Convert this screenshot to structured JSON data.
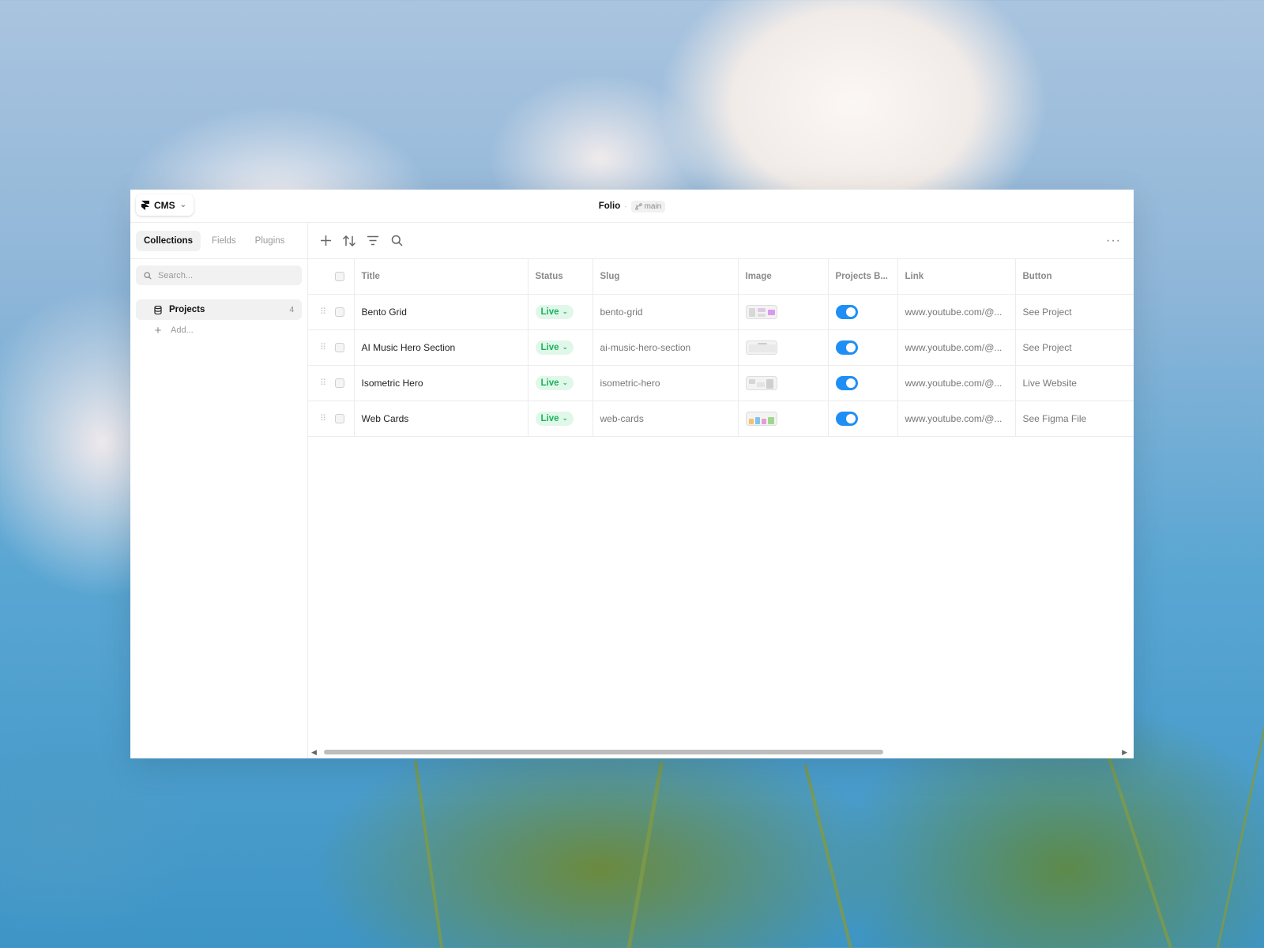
{
  "window": {
    "app_button_label": "CMS",
    "project_name": "Folio",
    "separator": "·",
    "branch": "main"
  },
  "sidebar": {
    "tabs": [
      {
        "label": "Collections",
        "active": true
      },
      {
        "label": "Fields",
        "active": false
      },
      {
        "label": "Plugins",
        "active": false
      }
    ],
    "search_placeholder": "Search...",
    "collections": [
      {
        "label": "Projects",
        "count": "4",
        "icon": "database-icon"
      }
    ],
    "add_label": "Add..."
  },
  "toolbar": {
    "icons": [
      "plus-icon",
      "sort-icon",
      "filter-icon",
      "search-icon"
    ],
    "more": "···"
  },
  "table": {
    "columns": [
      "Title",
      "Status",
      "Slug",
      "Image",
      "Projects B...",
      "Link",
      "Button"
    ],
    "rows": [
      {
        "title": "Bento Grid",
        "status": "Live",
        "slug": "bento-grid",
        "toggle": true,
        "link": "www.youtube.com/@...",
        "button": "See Project"
      },
      {
        "title": "AI Music Hero Section",
        "status": "Live",
        "slug": "ai-music-hero-section",
        "toggle": true,
        "link": "www.youtube.com/@...",
        "button": "See Project"
      },
      {
        "title": "Isometric Hero",
        "status": "Live",
        "slug": "isometric-hero",
        "toggle": true,
        "link": "www.youtube.com/@...",
        "button": "Live Website"
      },
      {
        "title": "Web Cards",
        "status": "Live",
        "slug": "web-cards",
        "toggle": true,
        "link": "www.youtube.com/@...",
        "button": "See Figma File"
      }
    ]
  },
  "colors": {
    "accent_toggle": "#1f8ff5",
    "status_live_text": "#17b45a",
    "status_live_bg": "#e1f7ea"
  }
}
